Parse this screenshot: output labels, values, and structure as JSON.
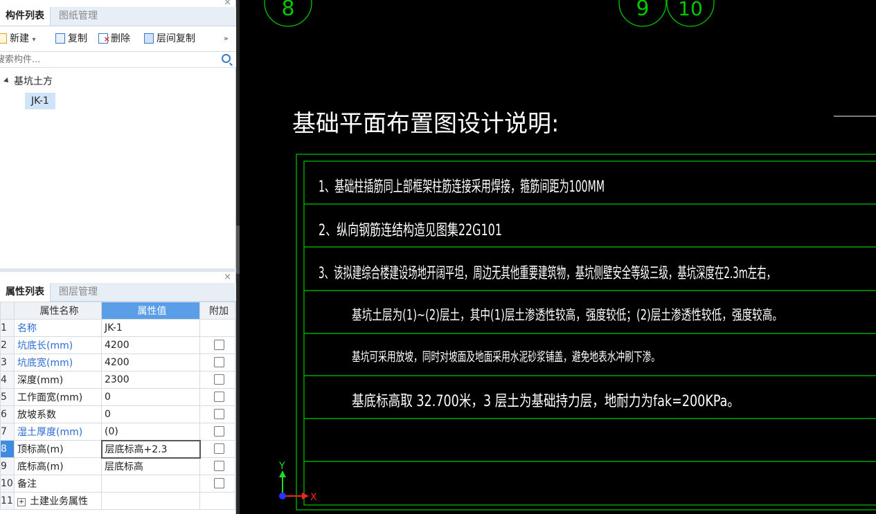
{
  "component_panel": {
    "tabs": [
      "构件列表",
      "图纸管理"
    ],
    "toolbar": {
      "new": "新建",
      "copy": "复制",
      "delete": "删除",
      "floor_copy": "层间复制",
      "more": "»"
    },
    "search_placeholder": "搜索构件...",
    "tree": {
      "root": "基坑土方",
      "child": "JK-1"
    }
  },
  "property_panel": {
    "tabs": [
      "属性列表",
      "图层管理"
    ],
    "headers": [
      "属性名称",
      "属性值",
      "附加"
    ],
    "rows": [
      {
        "no": "1",
        "name": "名称",
        "value": "JK-1"
      },
      {
        "no": "2",
        "name": "坑底长(mm)",
        "value": "4200"
      },
      {
        "no": "3",
        "name": "坑底宽(mm)",
        "value": "4200"
      },
      {
        "no": "4",
        "name": "深度(mm)",
        "value": "2300"
      },
      {
        "no": "5",
        "name": "工作面宽(mm)",
        "value": "0"
      },
      {
        "no": "6",
        "name": "放坡系数",
        "value": "0"
      },
      {
        "no": "7",
        "name": "湿土厚度(mm)",
        "value": "(0)"
      },
      {
        "no": "8",
        "name": "顶标高(m)",
        "value": "层底标高+2.3"
      },
      {
        "no": "9",
        "name": "底标高(m)",
        "value": "层底标高"
      },
      {
        "no": "10",
        "name": "备注",
        "value": ""
      },
      {
        "no": "11",
        "name": "土建业务属性",
        "value": ""
      }
    ]
  },
  "drawing": {
    "axis_bubbles": [
      "8",
      "9",
      "10"
    ],
    "title": "基础平面布置图设计说明:",
    "lines": [
      "1、基础柱插筋同上部框架柱筋连接采用焊接，箍筋间距为100MM",
      "2、纵向钢筋连结构造见图集22G101",
      "3、该拟建综合楼建设场地开阔平坦，周边无其他重要建筑物，基坑侧壁安全等级三级，基坑深度在2.3m左右，",
      "基坑土层为(1)~(2)层土，其中(1)层土渗透性较高，强度较低；(2)层土渗透性较低，强度较高。",
      "基坑可采用放坡，同时对坡面及地面采用水泥砂浆铺盖，避免地表水冲刷下渗。",
      "基底标高取 32.700米，3 层土为基础持力层，地耐力为fak=200KPa。"
    ],
    "ucs": {
      "x": "X",
      "y": "Y"
    },
    "colors": {
      "frame": "#00c800",
      "text": "#ffffff",
      "ucs_x": "#ff2020",
      "ucs_y": "#20e020",
      "ucs_origin": "#3030ff"
    }
  }
}
